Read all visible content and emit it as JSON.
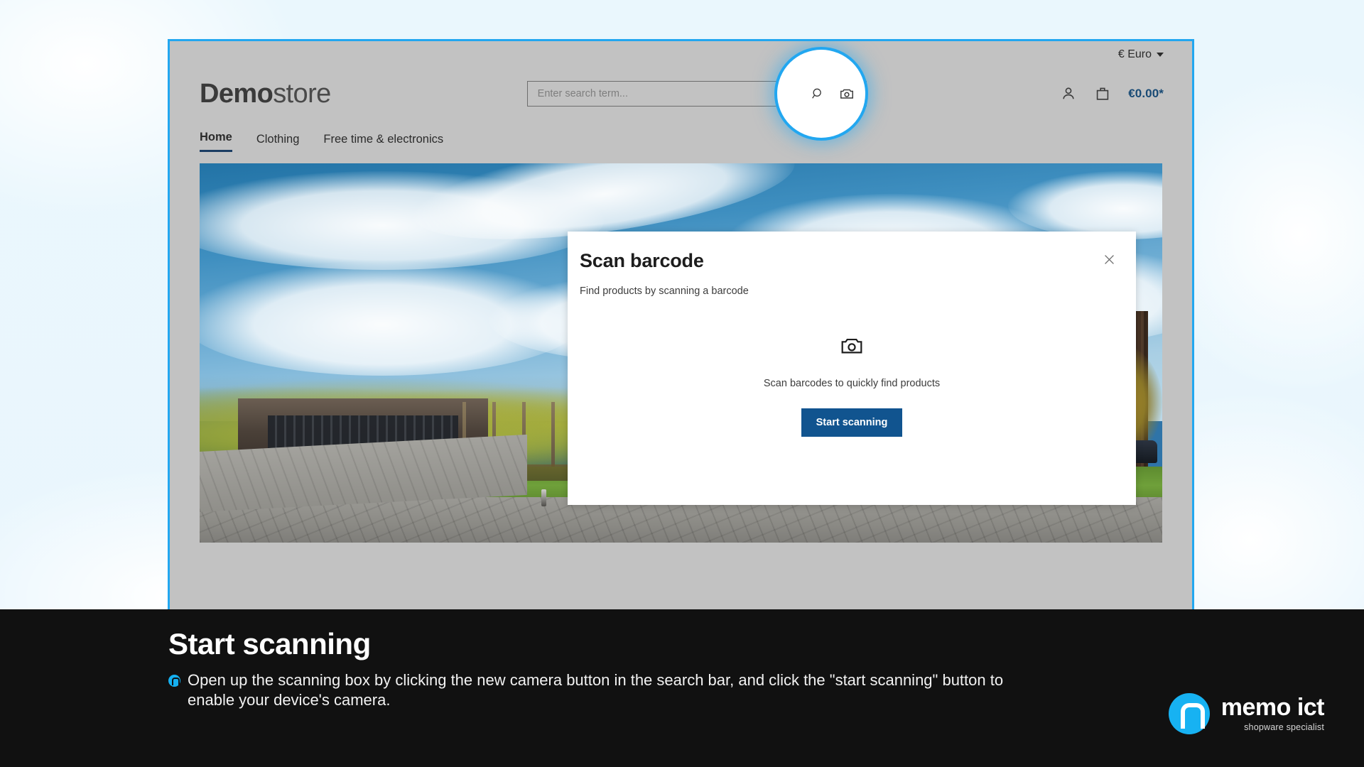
{
  "shop": {
    "logo_bold": "Demo",
    "logo_light": "store",
    "currency_label": "€ Euro",
    "cart_total": "€0.00*"
  },
  "search": {
    "placeholder": "Enter search term...",
    "value": "",
    "search_icon": "magnifier-icon",
    "camera_icon": "camera-icon"
  },
  "account": {
    "user_icon": "user-icon",
    "cart_icon": "shopping-bag-icon"
  },
  "nav": {
    "items": [
      {
        "label": "Home",
        "active": true
      },
      {
        "label": "Clothing",
        "active": false
      },
      {
        "label": "Free time & electronics",
        "active": false
      }
    ]
  },
  "modal": {
    "title": "Scan barcode",
    "subtitle": "Find products by scanning a barcode",
    "close_icon": "close-icon",
    "camera_icon": "camera-icon",
    "hint": "Scan barcodes to quickly find products",
    "primary_button": "Start scanning"
  },
  "caption": {
    "title": "Start scanning",
    "body": "Open up the scanning box by clicking the new camera button in the search bar, and click the \"start scanning\" button to enable your device's camera.",
    "bullet_icon": "memo-bullet-icon"
  },
  "brand": {
    "name": "memo ict",
    "tagline": "shopware specialist",
    "mark_icon": "memo-logo-icon",
    "accent": "#17b2f2"
  },
  "colors": {
    "frame_border": "#22a7f0",
    "page_background": "#eaf7fd",
    "site_background": "#c2c2c2",
    "primary_button": "#11548f",
    "cart_price": "#184a75",
    "banner_background": "#111111"
  }
}
